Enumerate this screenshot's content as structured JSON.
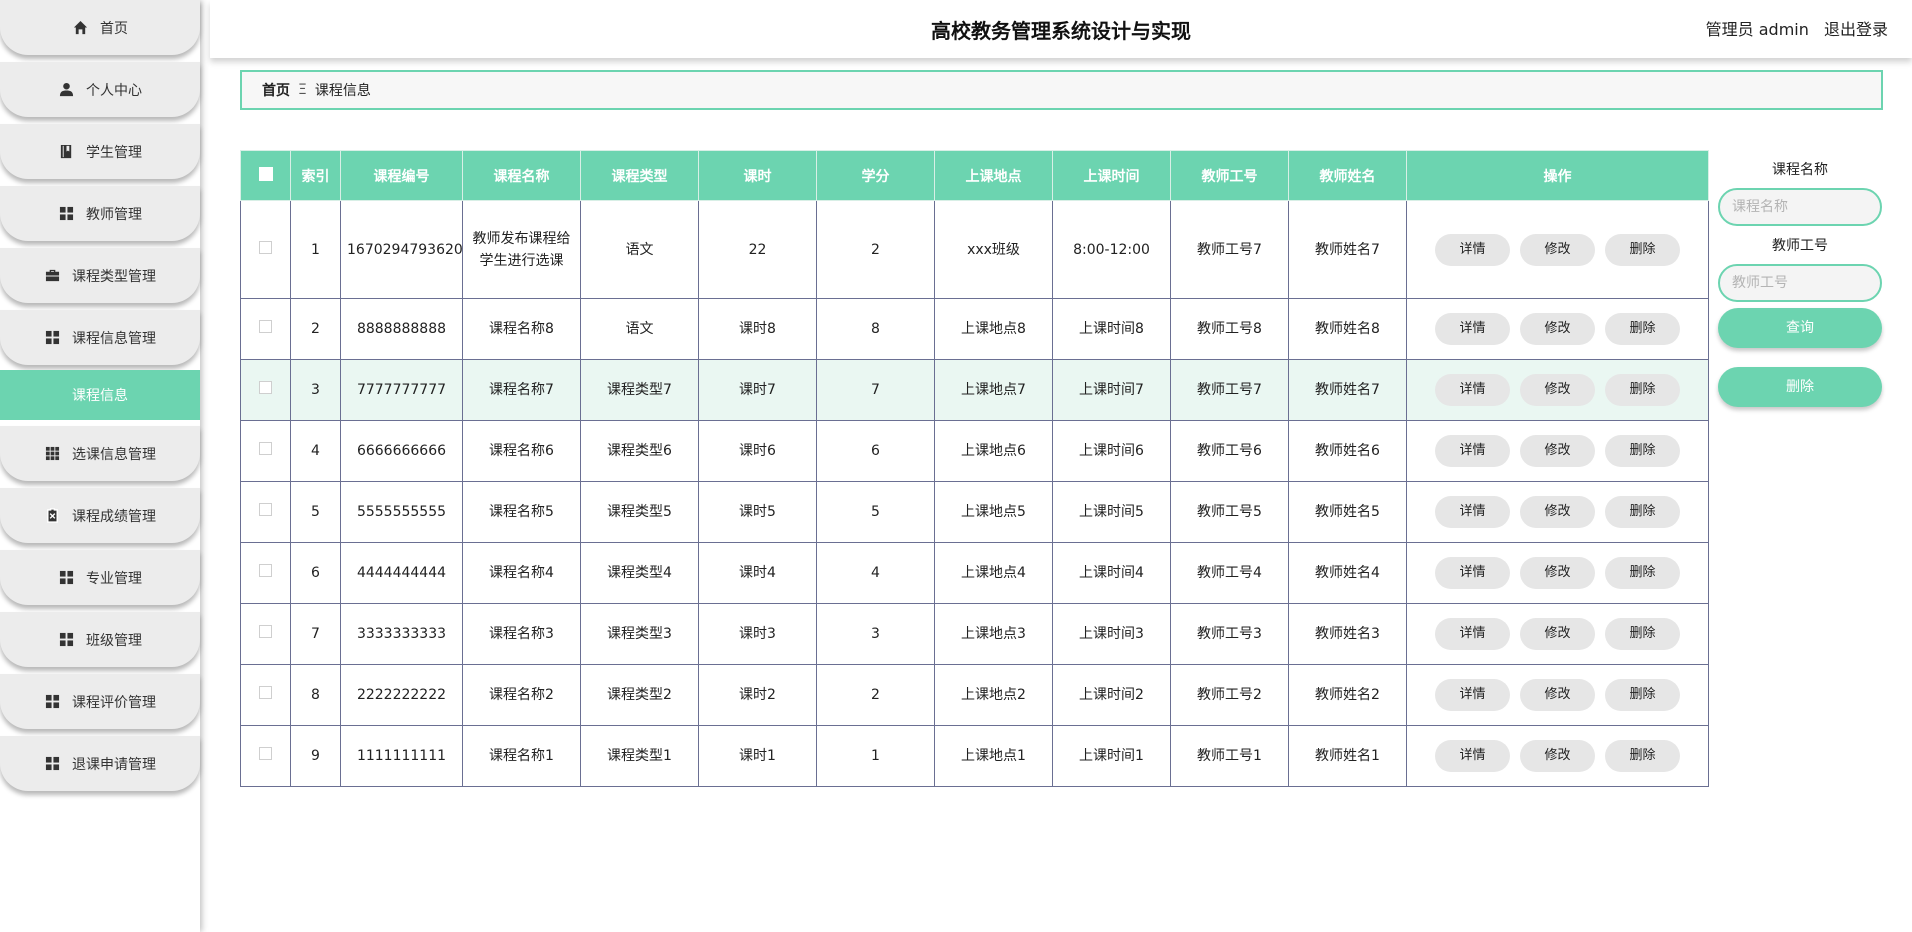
{
  "header": {
    "title": "高校教务管理系统设计与实现",
    "user": "管理员 admin",
    "logout": "退出登录"
  },
  "sidebar": {
    "items": [
      {
        "label": "首页",
        "icon": "home-icon"
      },
      {
        "label": "个人中心",
        "icon": "user-icon"
      },
      {
        "label": "学生管理",
        "icon": "book-icon"
      },
      {
        "label": "教师管理",
        "icon": "grid-icon"
      },
      {
        "label": "课程类型管理",
        "icon": "briefcase-icon"
      },
      {
        "label": "课程信息管理",
        "icon": "grid-icon"
      },
      {
        "label": "选课信息管理",
        "icon": "apps-icon"
      },
      {
        "label": "课程成绩管理",
        "icon": "clipboard-icon"
      },
      {
        "label": "专业管理",
        "icon": "grid-icon"
      },
      {
        "label": "班级管理",
        "icon": "grid-icon"
      },
      {
        "label": "课程评价管理",
        "icon": "grid-icon"
      },
      {
        "label": "退课申请管理",
        "icon": "grid-icon"
      }
    ],
    "active_sub": "课程信息"
  },
  "breadcrumb": {
    "home": "首页",
    "separator": "Ξ",
    "current": "课程信息"
  },
  "table": {
    "columns": [
      "索引",
      "课程编号",
      "课程名称",
      "课程类型",
      "课时",
      "学分",
      "上课地点",
      "上课时间",
      "教师工号",
      "教师姓名",
      "操作"
    ],
    "rows": [
      [
        "1",
        "1670294793620",
        "教师发布课程给学生进行选课",
        "语文",
        "22",
        "2",
        "xxx班级",
        "8:00-12:00",
        "教师工号7",
        "教师姓名7"
      ],
      [
        "2",
        "8888888888",
        "课程名称8",
        "语文",
        "课时8",
        "8",
        "上课地点8",
        "上课时间8",
        "教师工号8",
        "教师姓名8"
      ],
      [
        "3",
        "7777777777",
        "课程名称7",
        "课程类型7",
        "课时7",
        "7",
        "上课地点7",
        "上课时间7",
        "教师工号7",
        "教师姓名7"
      ],
      [
        "4",
        "6666666666",
        "课程名称6",
        "课程类型6",
        "课时6",
        "6",
        "上课地点6",
        "上课时间6",
        "教师工号6",
        "教师姓名6"
      ],
      [
        "5",
        "5555555555",
        "课程名称5",
        "课程类型5",
        "课时5",
        "5",
        "上课地点5",
        "上课时间5",
        "教师工号5",
        "教师姓名5"
      ],
      [
        "6",
        "4444444444",
        "课程名称4",
        "课程类型4",
        "课时4",
        "4",
        "上课地点4",
        "上课时间4",
        "教师工号4",
        "教师姓名4"
      ],
      [
        "7",
        "3333333333",
        "课程名称3",
        "课程类型3",
        "课时3",
        "3",
        "上课地点3",
        "上课时间3",
        "教师工号3",
        "教师姓名3"
      ],
      [
        "8",
        "2222222222",
        "课程名称2",
        "课程类型2",
        "课时2",
        "2",
        "上课地点2",
        "上课时间2",
        "教师工号2",
        "教师姓名2"
      ],
      [
        "9",
        "1111111111",
        "课程名称1",
        "课程类型1",
        "课时1",
        "1",
        "上课地点1",
        "上课时间1",
        "教师工号1",
        "教师姓名1"
      ]
    ],
    "actions": {
      "detail": "详情",
      "edit": "修改",
      "delete": "删除"
    }
  },
  "search": {
    "name_label": "课程名称",
    "name_placeholder": "课程名称",
    "teacher_label": "教师工号",
    "teacher_placeholder": "教师工号",
    "query": "查询",
    "delete": "删除"
  },
  "colors": {
    "accent": "#6cd4b0",
    "row_highlight": "#eaf7f2",
    "button_grey": "#e6e6e6"
  }
}
